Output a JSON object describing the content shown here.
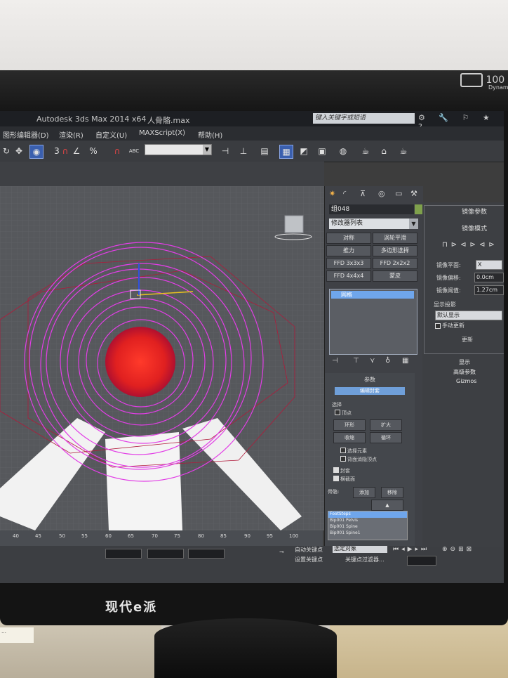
{
  "app": {
    "title": "Autodesk 3ds Max  2014 x64",
    "file": "人骨骼.max",
    "search_placeholder": "键入关键字或短语",
    "title_icons": "⚙ 🔧 ⚐ ★ ?"
  },
  "monitor": {
    "brand": "现代e派",
    "badge_number": "100",
    "badge_text": "Dynam"
  },
  "menu": [
    {
      "label": "图形编辑器(D)"
    },
    {
      "label": "渲染(R)"
    },
    {
      "label": "自定义(U)"
    },
    {
      "label": "MAXScript(X)"
    },
    {
      "label": "帮助(H)"
    }
  ],
  "toolbar": {
    "snap3": "3",
    "percent_snap": "%",
    "abc": "ABC"
  },
  "command_panel": {
    "object_name": "组048",
    "modifier_list": "修改器列表",
    "buttons": [
      {
        "label": "对称"
      },
      {
        "label": "涡轮平滑"
      },
      {
        "label": "推力"
      },
      {
        "label": "多边形选择"
      },
      {
        "label": "FFD 3x3x3"
      },
      {
        "label": "FFD 2x2x2"
      },
      {
        "label": "FFD 4x4x4"
      },
      {
        "label": "蒙皮"
      }
    ],
    "stack_item": "网格",
    "rollout_title": "参数",
    "edit_envelopes": "编辑封套",
    "selection_label": "选择",
    "vertex_label": "顶点",
    "options": [
      "环形",
      "扩大",
      "收缩",
      "循环"
    ],
    "select_element": "选择元素",
    "backface": "背面消隐顶点",
    "envelopes": "封套",
    "cross_sections": "横截面",
    "bones_label": "骨骼:",
    "add": "添加",
    "remove": "移除",
    "bone_list": [
      "FootSteps",
      "Bip001 Pelvis",
      "Bip001 Spine",
      "Bip001 Spine1"
    ]
  },
  "mirror_panel": {
    "title": "镜像参数",
    "mode": "镜像模式",
    "plane_label": "镜像平面:",
    "plane_value": "X",
    "offset_label": "镜像偏移:",
    "offset_value": "0.0cm",
    "threshold_label": "镜像阈值:",
    "threshold_value": "1.27cm",
    "display_label": "显示投影",
    "display_value": "默认显示",
    "manual_update": "手动更新",
    "update": "更新",
    "display": "显示",
    "advanced": "高级参数",
    "gizmos": "Gizmos"
  },
  "timeline": {
    "ticks": [
      "40",
      "45",
      "50",
      "55",
      "60",
      "65",
      "70",
      "75",
      "80",
      "85",
      "90",
      "95",
      "100"
    ]
  },
  "status": {
    "auto_key": "自动关键点",
    "set_key": "设置关键点",
    "selected": "选定对象",
    "key_filters": "关键点过滤器..."
  }
}
